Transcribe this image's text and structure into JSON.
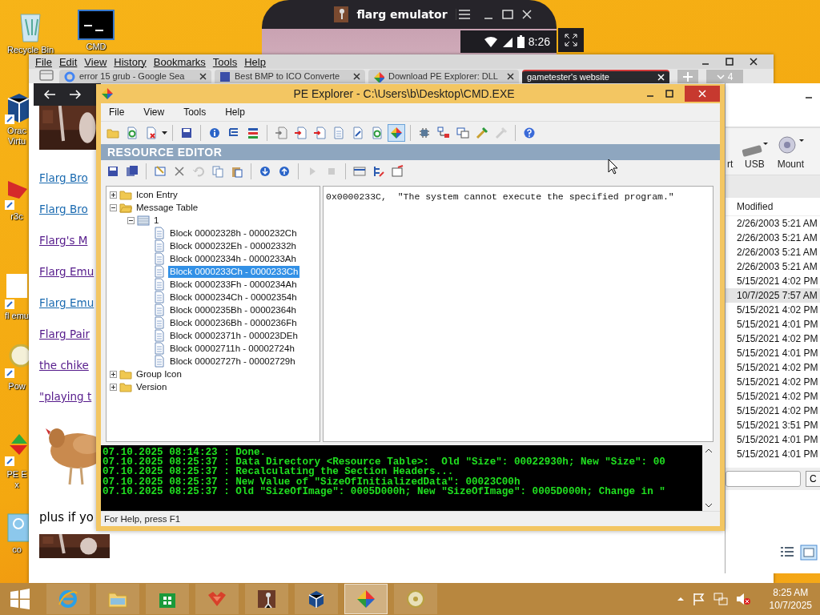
{
  "desktop_icons": [
    {
      "label": "Recycle Bin",
      "kind": "bin"
    },
    {
      "label": "CMD",
      "kind": "console"
    },
    {
      "label": "Orac Virtu",
      "kind": "box"
    },
    {
      "label": "r3c",
      "kind": "red"
    },
    {
      "label": "fl emu",
      "kind": "blank"
    },
    {
      "label": "Pow",
      "kind": "disc"
    },
    {
      "label": "PE Ex",
      "kind": "pe"
    },
    {
      "label": "co",
      "kind": "app"
    }
  ],
  "emulator_window": {
    "title": "flarg emulator",
    "clock": "8:26"
  },
  "browser": {
    "menu": [
      "File",
      "Edit",
      "View",
      "History",
      "Bookmarks",
      "Tools",
      "Help"
    ],
    "tabs": [
      {
        "label": "error 15 grub - Google Sea",
        "selected": false
      },
      {
        "label": "Best BMP to ICO Converte",
        "selected": false
      },
      {
        "label": "Download PE Explorer: DLL",
        "selected": false
      },
      {
        "label": "gametester's website",
        "selected": true
      }
    ],
    "tab_count": "4",
    "links": [
      {
        "text": "Flarg Bro",
        "visited": false
      },
      {
        "text": "Flarg Bro",
        "visited": false
      },
      {
        "text": "Flarg's M",
        "visited": true
      },
      {
        "text": "Flarg Emu",
        "visited": true
      },
      {
        "text": "Flarg Emu",
        "visited": false
      },
      {
        "text": "Flarg Pair",
        "visited": true
      },
      {
        "text": "the  chike",
        "visited": true
      },
      {
        "text": "\"playing t",
        "visited": true
      }
    ],
    "trailing_text": "plus if yo"
  },
  "file_window": {
    "ribbon": [
      {
        "label": "rt",
        "kind": "cut"
      },
      {
        "label": "USB",
        "kind": "usb"
      },
      {
        "label": "Mount",
        "kind": "mount"
      }
    ],
    "column": "Modified",
    "rows": [
      {
        "modified": "2/26/2003 5:21 AM",
        "selected": false
      },
      {
        "modified": "2/26/2003 5:21 AM",
        "selected": false
      },
      {
        "modified": "2/26/2003 5:21 AM",
        "selected": false
      },
      {
        "modified": "2/26/2003 5:21 AM",
        "selected": false
      },
      {
        "modified": "5/15/2021 4:02 PM",
        "selected": false
      },
      {
        "modified": "10/7/2025 7:57 AM",
        "selected": true
      },
      {
        "modified": "5/15/2021 4:02 PM",
        "selected": false
      },
      {
        "modified": "5/15/2021 4:01 PM",
        "selected": false
      },
      {
        "modified": "5/15/2021 4:02 PM",
        "selected": false
      },
      {
        "modified": "5/15/2021 4:01 PM",
        "selected": false
      },
      {
        "modified": "5/15/2021 4:02 PM",
        "selected": false
      },
      {
        "modified": "5/15/2021 4:02 PM",
        "selected": false
      },
      {
        "modified": "5/15/2021 4:02 PM",
        "selected": false
      },
      {
        "modified": "5/15/2021 4:02 PM",
        "selected": false
      },
      {
        "modified": "5/15/2021 3:51 PM",
        "selected": false
      },
      {
        "modified": "5/15/2021 4:01 PM",
        "selected": false
      },
      {
        "modified": "5/15/2021 4:01 PM",
        "selected": false
      }
    ],
    "button": "C"
  },
  "pe_explorer": {
    "title": "PE Explorer - C:\\Users\\b\\Desktop\\CMD.EXE",
    "menu": [
      "File",
      "View",
      "Tools",
      "Help"
    ],
    "toolbar": [
      [
        {
          "pressed": false,
          "disabled": false
        },
        {
          "pressed": false,
          "disabled": false
        },
        {
          "pressed": false,
          "disabled": false
        }
      ],
      [
        {
          "pressed": false,
          "disabled": false
        }
      ],
      [
        {
          "pressed": false,
          "disabled": false
        },
        {
          "pressed": false,
          "disabled": false
        },
        {
          "pressed": false,
          "disabled": false
        }
      ],
      [
        {
          "pressed": false,
          "disabled": false
        },
        {
          "pressed": false,
          "disabled": false
        },
        {
          "pressed": false,
          "disabled": false
        },
        {
          "pressed": false,
          "disabled": false
        },
        {
          "pressed": false,
          "disabled": false
        },
        {
          "pressed": false,
          "disabled": false
        },
        {
          "pressed": true,
          "disabled": false
        }
      ],
      [
        {
          "pressed": false,
          "disabled": false
        },
        {
          "pressed": false,
          "disabled": false
        },
        {
          "pressed": false,
          "disabled": false
        },
        {
          "pressed": false,
          "disabled": false
        },
        {
          "pressed": false,
          "disabled": true
        }
      ],
      [
        {
          "pressed": false,
          "disabled": false
        }
      ]
    ],
    "section": "RESOURCE EDITOR",
    "edit_toolbar": [
      [
        {
          "disabled": false
        },
        {
          "disabled": false
        }
      ],
      [
        {
          "disabled": false
        },
        {
          "disabled": false
        },
        {
          "disabled": true
        },
        {
          "disabled": false
        },
        {
          "disabled": false
        }
      ],
      [
        {
          "disabled": false
        },
        {
          "disabled": false
        }
      ],
      [
        {
          "disabled": true
        },
        {
          "disabled": true
        }
      ],
      [
        {
          "disabled": false
        },
        {
          "disabled": false
        },
        {
          "disabled": false
        }
      ]
    ],
    "tree": [
      {
        "label": "Icon Entry",
        "expanded": false,
        "selected": false
      },
      {
        "label": "Message Table",
        "expanded": true,
        "selected": false,
        "children": [
          {
            "label": "1",
            "expanded": true,
            "selected": false,
            "children": [
              {
                "label": "Block 00002328h - 0000232Ch",
                "selected": false
              },
              {
                "label": "Block 0000232Eh - 00002332h",
                "selected": false
              },
              {
                "label": "Block 00002334h - 0000233Ah",
                "selected": false
              },
              {
                "label": "Block 0000233Ch - 0000233Ch",
                "selected": true
              },
              {
                "label": "Block 0000233Fh - 0000234Ah",
                "selected": false
              },
              {
                "label": "Block 0000234Ch - 00002354h",
                "selected": false
              },
              {
                "label": "Block 0000235Bh - 00002364h",
                "selected": false
              },
              {
                "label": "Block 0000236Bh - 0000236Fh",
                "selected": false
              },
              {
                "label": "Block 00002371h - 000023DEh",
                "selected": false
              },
              {
                "label": "Block 00002711h - 00002724h",
                "selected": false
              },
              {
                "label": "Block 00002727h - 00002729h",
                "selected": false
              }
            ]
          }
        ]
      },
      {
        "label": "Group Icon",
        "expanded": false,
        "selected": false
      },
      {
        "label": "Version",
        "expanded": false,
        "selected": false
      }
    ],
    "message": "0x0000233C,  \"The system cannot execute the specified program.\"",
    "log": [
      "07.10.2025 08:14:23 : Done.",
      "07.10.2025 08:25:37 : Data Directory <Resource Table>:  Old \"Size\": 00022930h; New \"Size\": 00",
      "07.10.2025 08:25:37 : Recalculating the Section Headers...",
      "07.10.2025 08:25:37 : New Value of \"SizeOfInitializedData\": 00023C00h",
      "07.10.2025 08:25:37 : Old \"SizeOfImage\": 0005D000h; New \"SizeOfImage\": 0005D000h; Change in \""
    ],
    "status": "For Help, press F1"
  },
  "taskbar": {
    "apps": [
      {
        "active": false
      },
      {
        "active": false
      },
      {
        "active": false
      },
      {
        "active": false
      },
      {
        "active": false
      },
      {
        "active": false
      },
      {
        "active": true
      },
      {
        "active": false
      }
    ],
    "time": "8:25 AM",
    "date": "10/7/2025"
  }
}
